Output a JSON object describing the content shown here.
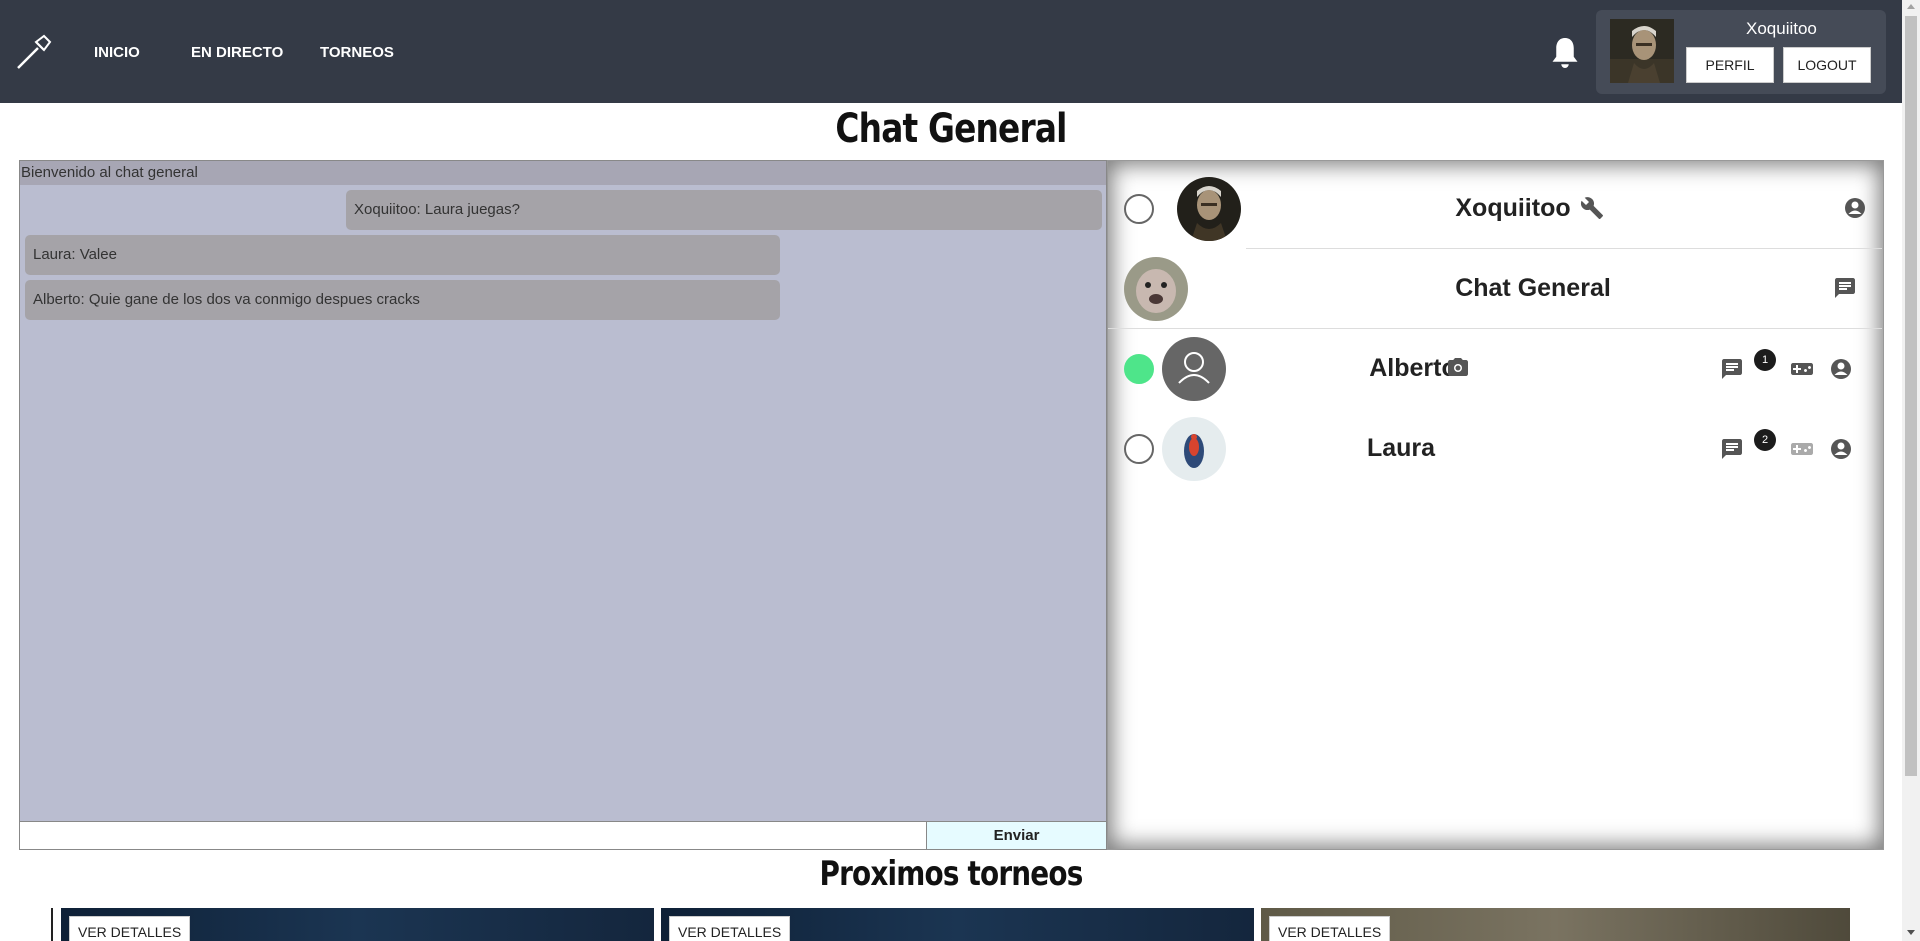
{
  "nav": {
    "links": [
      "INICIO",
      "EN DIRECTO",
      "TORNEOS"
    ]
  },
  "user": {
    "name": "Xoquiitoo",
    "profile_label": "PERFIL",
    "logout_label": "LOGOUT"
  },
  "page": {
    "title": "Chat General",
    "tournaments_title": "Proximos torneos"
  },
  "chat": {
    "welcome": "Bienvenido al chat general",
    "messages": [
      {
        "text": "Xoquiitoo: Laura juegas?",
        "own": true
      },
      {
        "text": "Laura: Valee",
        "own": false
      },
      {
        "text": "Alberto: Quie gane de los dos va conmigo despues cracks",
        "own": false
      }
    ],
    "input_value": "",
    "send_label": "Enviar"
  },
  "users": [
    {
      "name": "Xoquiitoo",
      "online": false,
      "extra_icon": "wrench-icon",
      "actions": [
        "account-icon"
      ]
    },
    {
      "name": "Chat General",
      "online": null,
      "actions": [
        "chat-icon"
      ]
    },
    {
      "name": "Alberto",
      "online": true,
      "extra_icon": "camera-icon",
      "unread": "1",
      "actions": [
        "chat-icon",
        "gamepad-icon",
        "account-icon"
      ]
    },
    {
      "name": "Laura",
      "online": false,
      "unread": "2",
      "actions": [
        "chat-icon",
        "gamepad-icon",
        "account-icon"
      ]
    }
  ],
  "tournaments": [
    {
      "button": "VER DETALLES"
    },
    {
      "button": "VER DETALLES"
    },
    {
      "button": "VER DETALLES"
    }
  ],
  "colors": {
    "topbar": "#343a46",
    "chat_bg": "#babdd0",
    "message_bg": "#a5a3a8",
    "online": "#4ee58a",
    "send_bg": "#e6fbff"
  }
}
